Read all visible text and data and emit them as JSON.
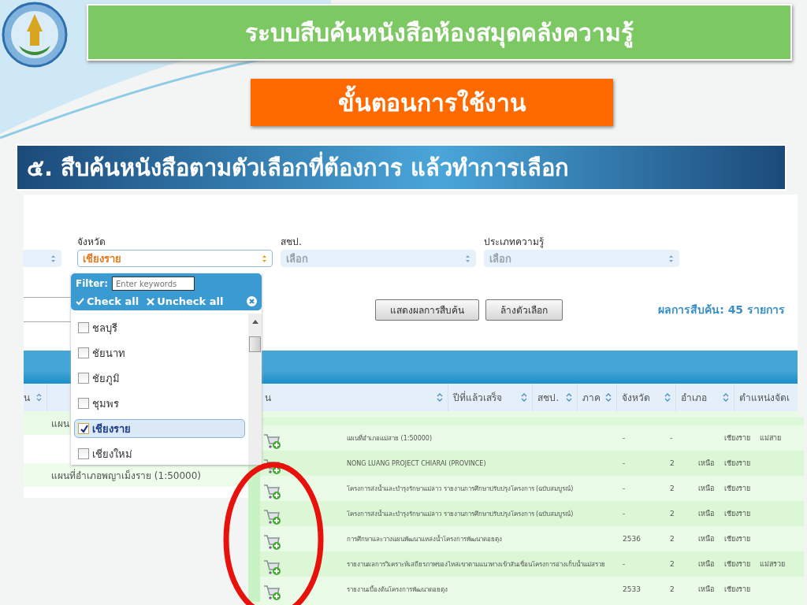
{
  "slide": {
    "title": "ระบบสืบค้นหนังสือห้องสมุดคลังความรู้",
    "subtitle": "ขั้นตอนการใช้งาน",
    "step": "๕. สืบค้นหนังสือตามตัวเลือกที่ต้องการ แล้วทำการเลือก"
  },
  "search_page": {
    "filters": [
      {
        "kind": "cut",
        "focused": false
      },
      {
        "kind": "select",
        "label": "จังหวัด",
        "value": "เชียงราย",
        "focused": true
      },
      {
        "kind": "select",
        "label": "สชป.",
        "placeholder": "เลือก",
        "focused": false
      },
      {
        "kind": "select",
        "label": "ประเภทความรู้",
        "placeholder": "เลือก",
        "focused": false
      }
    ],
    "buttons": [
      "แสดงผลการสืบค้น",
      "ล้างตัวเลือก"
    ],
    "result_count": "ผลการสืบค้น: 45 รายการ",
    "columns": [
      "น",
      "น",
      "ปีที่แล้วเสร็จ",
      "สชป.",
      "ภาค",
      "จังหวัด",
      "อำเภอ",
      "ตำแหน่งจัดเ"
    ],
    "rows": [
      "แผน",
      "แผนที่อำเภอพญาเม็งราย (1:50000)"
    ]
  },
  "dropdown": {
    "filter_label": "Filter:",
    "filter_placeholder": "Enter keywords",
    "check_all": "Check all",
    "uncheck_all": "Uncheck all",
    "options": [
      {
        "label": "ชลบุรี",
        "checked": false,
        "selected": false
      },
      {
        "label": "ชัยนาท",
        "checked": false,
        "selected": false
      },
      {
        "label": "ชัยภูมิ",
        "checked": false,
        "selected": false
      },
      {
        "label": "ชุมพร",
        "checked": false,
        "selected": false
      },
      {
        "label": "เชียงราย",
        "checked": true,
        "selected": true
      },
      {
        "label": "เชียงใหม่",
        "checked": false,
        "selected": false
      }
    ]
  },
  "results": {
    "rows": [
      {
        "title": "แผนที่อำเภอแม่สาย (1:50000)",
        "year": "-",
        "office": "-",
        "province": "เชียงราย",
        "district": "แม่สาย"
      },
      {
        "title": "NONG LUANG PROJECT CHIARAI (PROVINCE)",
        "year": "-",
        "office": "2",
        "region": "เหนือ",
        "province": "เชียงราย"
      },
      {
        "title": "โครงการส่งน้ำและบำรุงรักษาแม่ลาว รายงานการศึกษาปรับปรุงโครงการ (ฉบับสมบูรณ์)",
        "year": "-",
        "office": "2",
        "region": "เหนือ",
        "province": "เชียงราย"
      },
      {
        "title": "โครงการส่งน้ำและบำรุงรักษาแม่ลาว รายงานการศึกษาปรับปรุงโครงการ (ฉบับสมบูรณ์)",
        "year": "-",
        "office": "2",
        "region": "เหนือ",
        "province": "เชียงราย"
      },
      {
        "title": "การศึกษาและวางแผนพัฒนาแหล่งน้ำโครงการพัฒนาดอยตุง",
        "year": "2536",
        "office": "2",
        "region": "เหนือ",
        "province": "เชียงราย"
      },
      {
        "title": "รายงานผลการวิเคราะห์เสถียรภาพของไหล่เขาตามแนวทางเข้าสันเขื่อนโครงการอ่างเก็บน้ำแม่สรวย",
        "year": "-",
        "office": "2",
        "region": "เหนือ",
        "province": "เชียงราย",
        "district": "แม่สรวย"
      },
      {
        "title": "รายงานเบื้องต้นโครงการพัฒนาดอยตุง",
        "year": "2533",
        "office": "2",
        "region": "เหนือ",
        "province": "เชียงราย"
      }
    ]
  }
}
